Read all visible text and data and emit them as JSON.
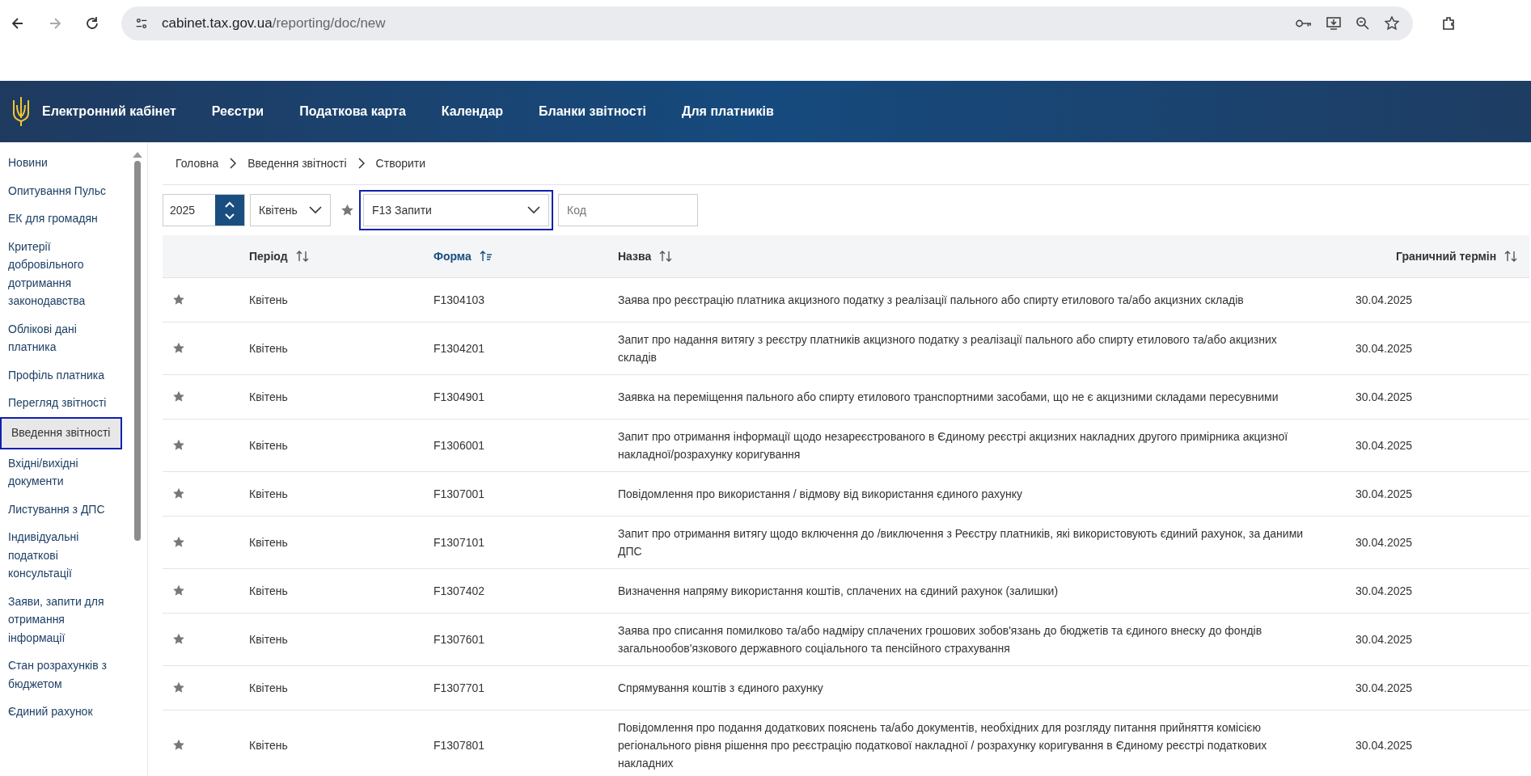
{
  "browser": {
    "url_host": "cabinet.tax.gov.ua",
    "url_path": "/reporting/doc/new",
    "forward_disabled": true
  },
  "header": {
    "brand": "Електронний кабінет",
    "nav": [
      "Реєстри",
      "Податкова карта",
      "Календар",
      "Бланки звітності",
      "Для платників"
    ]
  },
  "sidebar": {
    "items": [
      {
        "label": "Новини",
        "selected": false
      },
      {
        "label": "Опитування Пульс",
        "selected": false
      },
      {
        "label": "ЕК для громадян",
        "selected": false
      },
      {
        "label": "Критерії добровільного дотримання законодавства",
        "selected": false
      },
      {
        "label": "Облікові дані платника",
        "selected": false
      },
      {
        "label": "Профіль платника",
        "selected": false
      },
      {
        "label": "Перегляд звітності",
        "selected": false
      },
      {
        "label": "Введення звітності",
        "selected": true
      },
      {
        "label": "Вхідні/вихідні документи",
        "selected": false
      },
      {
        "label": "Листування з ДПС",
        "selected": false
      },
      {
        "label": "Індивідуальні податкові консультації",
        "selected": false
      },
      {
        "label": "Заяви, запити для отримання інформації",
        "selected": false
      },
      {
        "label": "Стан розрахунків з бюджетом",
        "selected": false
      },
      {
        "label": "Єдиний рахунок",
        "selected": false
      }
    ]
  },
  "breadcrumb": [
    "Головна",
    "Введення звітності",
    "Створити"
  ],
  "filters": {
    "year": "2025",
    "month": "Квітень",
    "form_group": "F13 Запити",
    "code_placeholder": "Код"
  },
  "table": {
    "columns": [
      {
        "label": "Період",
        "sorted": false
      },
      {
        "label": "Форма",
        "sorted": true
      },
      {
        "label": "Назва",
        "sorted": false
      },
      {
        "label": "Граничний термін",
        "sorted": false
      }
    ],
    "rows": [
      {
        "favorite": false,
        "period": "Квітень",
        "form": "F1304103",
        "name": "Заява про реєстрацію платника акцизного податку з реалізації пального або спирту етилового та/або акцизних складів",
        "deadline": "30.04.2025"
      },
      {
        "favorite": false,
        "period": "Квітень",
        "form": "F1304201",
        "name": "Запит про надання витягу з реєстру платників акцизного податку з реалізації пального або спирту етилового та/або акцизних складів",
        "deadline": "30.04.2025"
      },
      {
        "favorite": false,
        "period": "Квітень",
        "form": "F1304901",
        "name": "Заявка на переміщення пального або спирту етилового транспортними засобами, що не є акцизними складами пересувними",
        "deadline": "30.04.2025"
      },
      {
        "favorite": false,
        "period": "Квітень",
        "form": "F1306001",
        "name": "Запит про отримання інформації щодо незареєстрованого в Єдиному реєстрі акцизних накладних другого примірника акцизної накладної/розрахунку коригування",
        "deadline": "30.04.2025"
      },
      {
        "favorite": false,
        "period": "Квітень",
        "form": "F1307001",
        "name": "Повідомлення про використання / відмову від використання єдиного рахунку",
        "deadline": "30.04.2025"
      },
      {
        "favorite": false,
        "period": "Квітень",
        "form": "F1307101",
        "name": "Запит про отримання витягу щодо включення до /виключення з Реєстру платників, які використовують єдиний рахунок, за даними ДПС",
        "deadline": "30.04.2025"
      },
      {
        "favorite": false,
        "period": "Квітень",
        "form": "F1307402",
        "name": "Визначення напряму використання коштів, сплачених на єдиний рахунок (залишки)",
        "deadline": "30.04.2025"
      },
      {
        "favorite": false,
        "period": "Квітень",
        "form": "F1307601",
        "name": "Заява про списання помилково та/або надміру сплачених грошових зобов'язань до бюджетів та єдиного внеску до фондів загальнообов'язкового державного соціального та пенсійного страхування",
        "deadline": "30.04.2025"
      },
      {
        "favorite": false,
        "period": "Квітень",
        "form": "F1307701",
        "name": "Спрямування коштів з єдиного рахунку",
        "deadline": "30.04.2025"
      },
      {
        "favorite": false,
        "period": "Квітень",
        "form": "F1307801",
        "name": "Повідомлення про подання додаткових пояснень та/або документів, необхідних для розгляду питання прийняття комісією регіонального рівня рішення про реєстрацію податкової накладної / розрахунку коригування в Єдиному реєстрі податкових накладних",
        "deadline": "30.04.2025"
      }
    ]
  }
}
